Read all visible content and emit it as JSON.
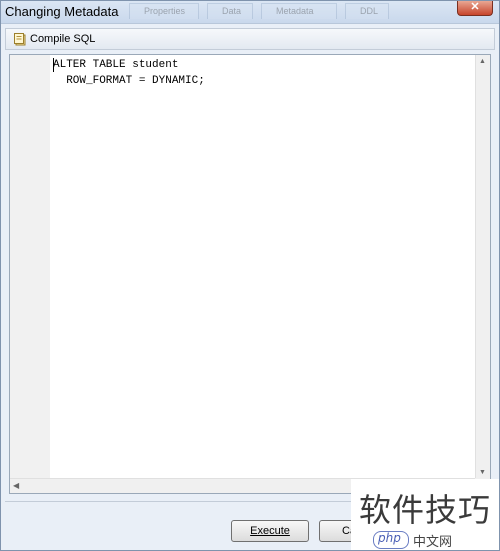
{
  "window": {
    "title": "Changing Metadata",
    "close_label": "✕",
    "background_tabs": [
      "Properties",
      "Data",
      "Metadata",
      "DDL"
    ]
  },
  "toolbar": {
    "compile_label": "Compile SQL"
  },
  "editor": {
    "lines": [
      "ALTER TABLE student",
      "  ROW_FORMAT = DYNAMIC;"
    ]
  },
  "buttons": {
    "execute_label": "Execute",
    "cancel_label": "Ca"
  },
  "watermark": {
    "text": "软件技巧",
    "logo": "php",
    "site": "中文网"
  },
  "colors": {
    "accent": "#4a5fb5",
    "close": "#c7442b"
  }
}
